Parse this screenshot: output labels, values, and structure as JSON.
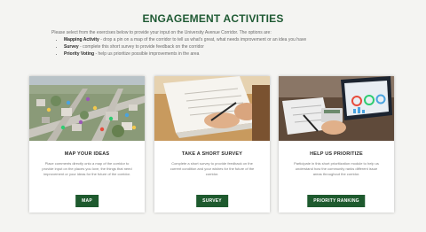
{
  "heading": "ENGAGEMENT ACTIVITIES",
  "intro": {
    "text": "Please select from the exercises below to provide your input on the University Avenue Corridor. The options are:",
    "items": [
      {
        "title": "Mapping Activity",
        "desc": " - drop a pin on a map of the corridor to tell us what's great, what needs improvement or an idea you have"
      },
      {
        "title": "Survey",
        "desc": " - complete this short survey to provide feedback on the corridor"
      },
      {
        "title": "Priority Voting",
        "desc": " - help us prioritize possible improvements in the area"
      }
    ]
  },
  "cards": [
    {
      "title": "MAP YOUR IDEAS",
      "desc": "Place comments directly onto a map of the corridor to provide input on the places you love, the things that need improvement or your ideas for the future of the corridor.",
      "button": "MAP"
    },
    {
      "title": "TAKE A SHORT SURVEY",
      "desc": "Complete a short survey to provide feedback on the current condition and your wishes for the future of the corridor.",
      "button": "SURVEY"
    },
    {
      "title": "HELP US PRIORITIZE",
      "desc": "Participate in this short prioritization module to help us understand how the community ranks different issue areas throughout the corridor.",
      "button": "PRIORITY RANKING"
    }
  ],
  "colors": {
    "heading": "#1f5a34",
    "button": "#1e5a2e",
    "background": "#f4f4f2"
  }
}
